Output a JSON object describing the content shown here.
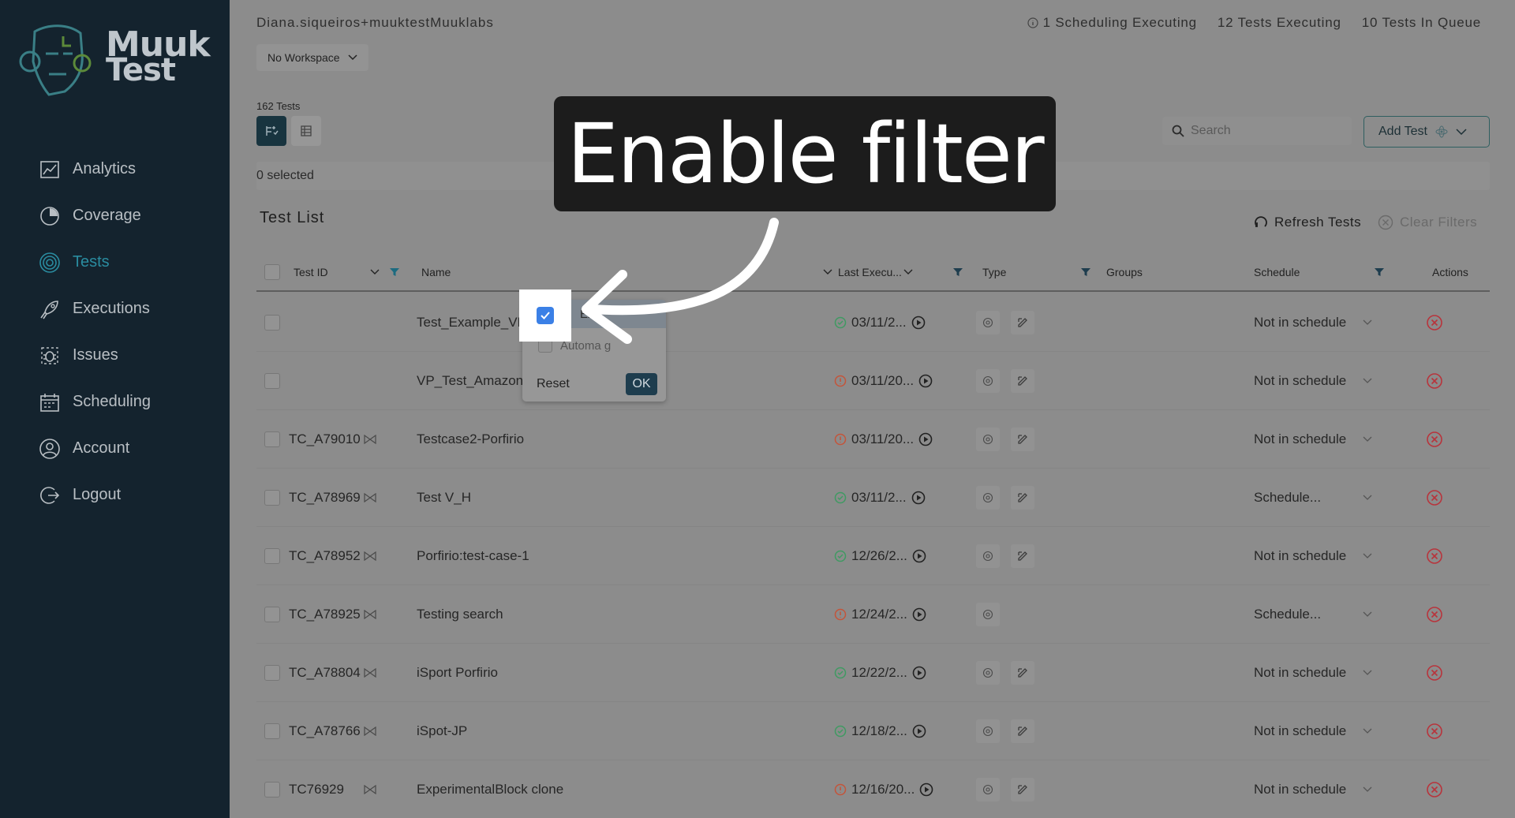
{
  "brand": {
    "line1": "Muuk",
    "line2": "Test"
  },
  "sidebar": {
    "items": [
      {
        "label": "Analytics",
        "icon": "chart-icon",
        "active": false
      },
      {
        "label": "Coverage",
        "icon": "coverage-icon",
        "active": false
      },
      {
        "label": "Tests",
        "icon": "target-icon",
        "active": true
      },
      {
        "label": "Executions",
        "icon": "rocket-icon",
        "active": false
      },
      {
        "label": "Issues",
        "icon": "bug-icon",
        "active": false
      },
      {
        "label": "Scheduling",
        "icon": "calendar-icon",
        "active": false
      },
      {
        "label": "Account",
        "icon": "user-icon",
        "active": false
      },
      {
        "label": "Logout",
        "icon": "logout-icon",
        "active": false
      }
    ]
  },
  "header": {
    "user": "Diana.siqueiros+muuktestMuuklabs",
    "scheduling": "1 Scheduling Executing",
    "tests_executing": "12 Tests Executing",
    "tests_queue": "10 Tests In Queue",
    "workspace": "No Workspace"
  },
  "toolbar": {
    "tests_count": "162  Tests",
    "search_placeholder": "Search",
    "add_test": "Add Test",
    "selected": "0 selected",
    "list_title": "Test List",
    "refresh": "Refresh Tests",
    "clear_filters": "Clear Filters"
  },
  "table": {
    "columns": {
      "test_id": "Test ID",
      "name": "Name",
      "last_exec": "Last Execu...",
      "type": "Type",
      "groups": "Groups",
      "schedule": "Schedule",
      "actions": "Actions"
    },
    "rows": [
      {
        "id": "",
        "name": "Test_Example_VP",
        "date": "03/11/2...",
        "status": "ok",
        "types": 2,
        "schedule": "Not in schedule"
      },
      {
        "id": "",
        "name": "VP_Test_Amazon_Site",
        "date": "03/11/20...",
        "status": "warn",
        "types": 2,
        "schedule": "Not in schedule"
      },
      {
        "id": "TC_A79010",
        "name": "Testcase2-Porfirio",
        "date": "03/11/20...",
        "status": "warn",
        "types": 2,
        "schedule": "Not in schedule"
      },
      {
        "id": "TC_A78969",
        "name": "Test V_H",
        "date": "03/11/2...",
        "status": "ok",
        "types": 2,
        "schedule": "Schedule..."
      },
      {
        "id": "TC_A78952",
        "name": "Porfirio:test-case-1",
        "date": "12/26/2...",
        "status": "ok",
        "types": 2,
        "schedule": "Not in schedule"
      },
      {
        "id": "TC_A78925",
        "name": "Testing search",
        "date": "12/24/2...",
        "status": "warn",
        "types": 1,
        "schedule": "Schedule..."
      },
      {
        "id": "TC_A78804",
        "name": "iSport Porfirio",
        "date": "12/22/2...",
        "status": "ok",
        "types": 2,
        "schedule": "Not in schedule"
      },
      {
        "id": "TC_A78766",
        "name": "iSpot-JP",
        "date": "12/18/2...",
        "status": "ok",
        "types": 2,
        "schedule": "Not in schedule"
      },
      {
        "id": "TC76929",
        "name": "ExperimentalBlock clone",
        "date": "12/16/20...",
        "status": "warn",
        "types": 2,
        "schedule": "Not in schedule"
      }
    ]
  },
  "filter_popup": {
    "option1": "Ex",
    "option2": "Automa  g",
    "reset": "Reset",
    "ok": "OK"
  },
  "annotation": {
    "text": "Enable filter"
  },
  "colors": {
    "sidebar": "#14232e",
    "accent": "#2a8ca0",
    "ok": "#3f9a62",
    "warn": "#c4543a",
    "danger": "#b8343c"
  }
}
